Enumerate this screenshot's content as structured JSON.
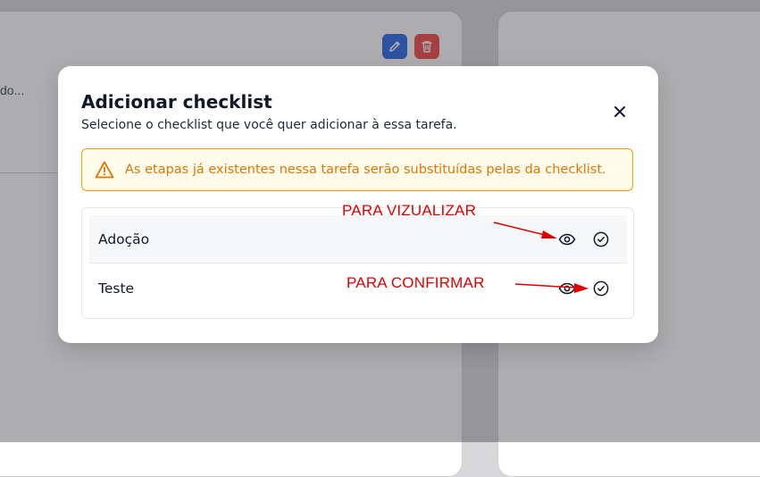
{
  "background": {
    "truncated_text": "do...",
    "edit_icon": "pencil-icon",
    "delete_icon": "trash-icon"
  },
  "modal": {
    "title": "Adicionar checklist",
    "subtitle": "Selecione o checklist que você quer adicionar à essa tarefa.",
    "close_icon": "close-icon",
    "alert": {
      "icon": "warning-icon",
      "text": "As etapas já existentes nessa tarefa serão substituídas pelas da checklist."
    },
    "checklists": [
      {
        "label": "Adoção",
        "view_icon": "eye-icon",
        "confirm_icon": "check-circle-icon"
      },
      {
        "label": "Teste",
        "view_icon": "eye-icon",
        "confirm_icon": "check-circle-icon"
      }
    ]
  },
  "annotations": {
    "view": "PARA VIZUALIZAR",
    "confirm": "PARA CONFIRMAR"
  },
  "colors": {
    "accent_warning": "#d97706",
    "annotation_red": "#e10000",
    "edit_blue": "#2563eb",
    "delete_red": "#ef4444"
  }
}
